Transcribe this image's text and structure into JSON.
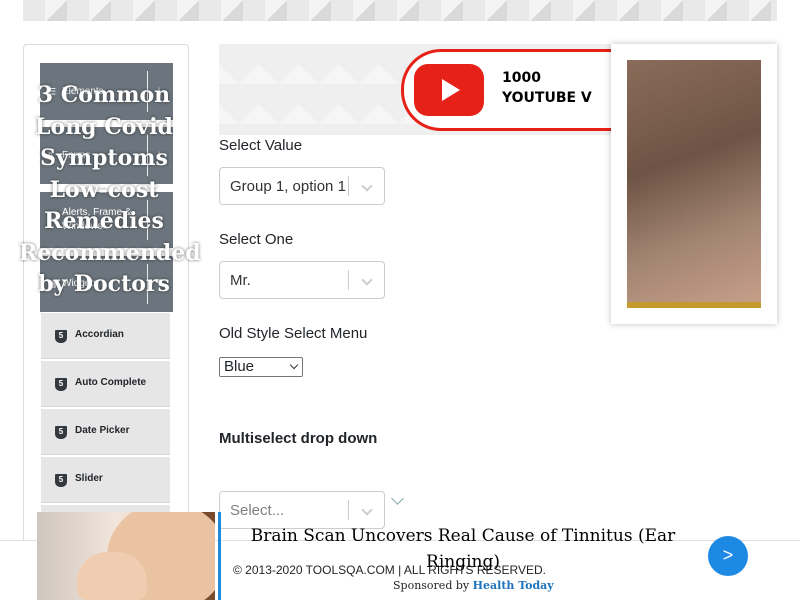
{
  "sidebar": {
    "groups": [
      {
        "label": "Elements",
        "icon": "hamburger-icon",
        "arrow": "download-icon"
      },
      {
        "label": "Forms",
        "icon": "document-icon",
        "arrow": "download-icon"
      },
      {
        "label": "Alerts, Frame & Windows",
        "icon": "window-icon",
        "arrow": "download-icon"
      },
      {
        "label": "Widgets",
        "icon": "grid-icon",
        "arrow": "upload-icon"
      }
    ],
    "widget_items": [
      "Accordian",
      "Auto Complete",
      "Date Picker",
      "Slider"
    ]
  },
  "ad_top": {
    "brand_text": "1000\nYOUTUBE V"
  },
  "form": {
    "select_value_label": "Select Value",
    "select_value_current": "Group 1, option 1",
    "select_one_label": "Select One",
    "select_one_current": "Mr.",
    "old_select_label": "Old Style Select Menu",
    "old_select_current": "Blue",
    "multiselect_label": "Multiselect drop down",
    "multiselect_placeholder": "Select..."
  },
  "ad_card": {
    "headline": "3 Common\nLong Covid\nSymptoms\nLow-cost\nRemedies\nRecommended\nby Doctors"
  },
  "footer": {
    "copyright": "© 2013-2020 TOOLSQA.COM | ALL RIGHTS RESERVED."
  },
  "ad_bottom": {
    "headline": "Brain Scan Uncovers Real Cause of Tinnitus (Ear Ringing)",
    "sponsored_prefix": "Sponsored by ",
    "sponsor": "Health Today",
    "next_label": ">"
  },
  "colors": {
    "sidebar_group_bg": "#6c757d",
    "sidebar_item_bg": "#e6e6e6",
    "youtube_red": "#e62117",
    "ad_next_blue": "#1e88e5"
  }
}
